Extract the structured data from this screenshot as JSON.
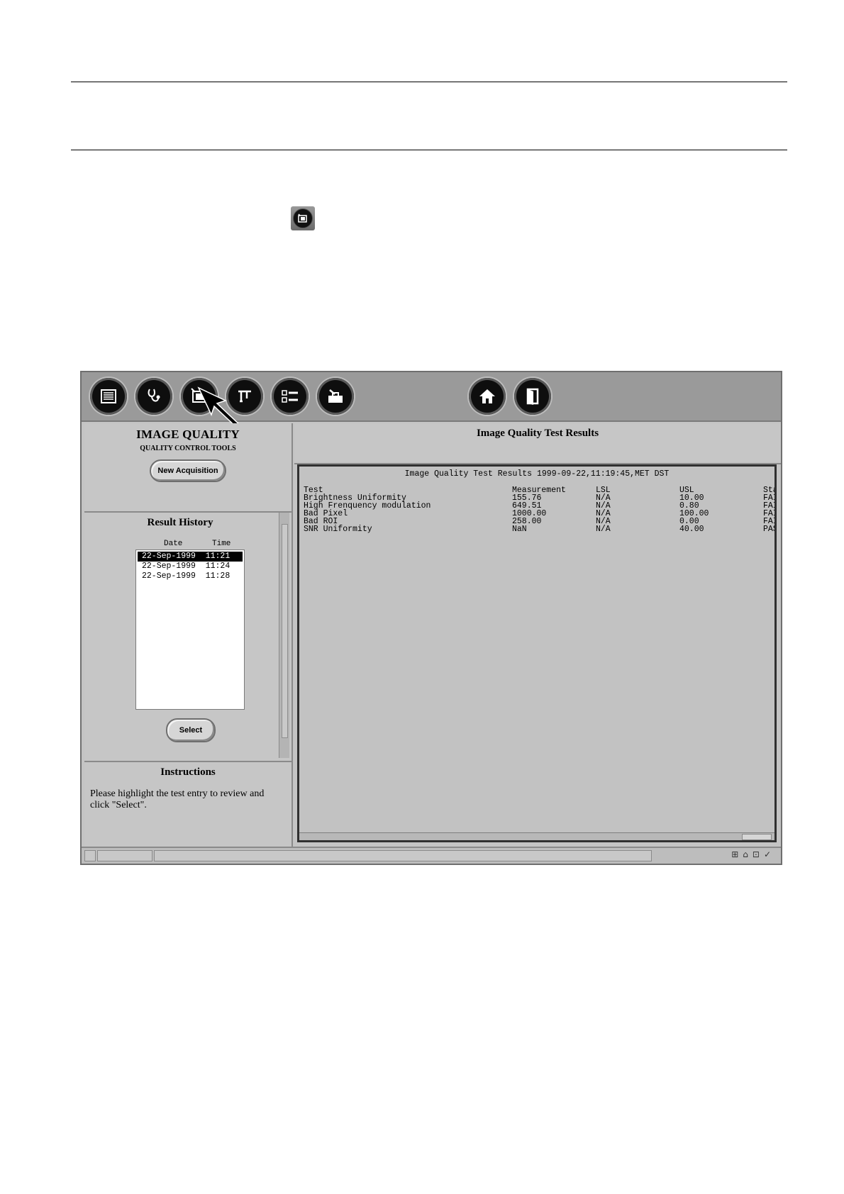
{
  "toolbar": {
    "buttons": [
      {
        "icon": "list-icon"
      },
      {
        "icon": "stethoscope-icon"
      },
      {
        "icon": "image-quality-icon"
      },
      {
        "icon": "caliper-icon"
      },
      {
        "icon": "checklist-icon"
      },
      {
        "icon": "toolbox-icon"
      },
      {
        "icon": "home-icon"
      },
      {
        "icon": "exit-door-icon"
      }
    ]
  },
  "left_panel": {
    "title": "IMAGE QUALITY",
    "subtitle": "QUALITY CONTROL TOOLS",
    "new_acquisition_label": "New Acquisition",
    "result_history": {
      "title": "Result History",
      "col_date": "Date",
      "col_time": "Time",
      "entries": [
        {
          "text": "22-Sep-1999  11:21",
          "selected": true
        },
        {
          "text": "22-Sep-1999  11:24",
          "selected": false
        },
        {
          "text": "22-Sep-1999  11:28",
          "selected": false
        }
      ],
      "select_label": "Select"
    },
    "instructions": {
      "title": "Instructions",
      "text": "Please highlight the test entry to review and click \"Select\"."
    }
  },
  "right_panel": {
    "header": "Image Quality Test Results",
    "report_title": "Image Quality Test Results 1999-09-22,11:19:45,MET DST",
    "columns": [
      "Test",
      "Measurement",
      "LSL",
      "USL",
      "Sta"
    ],
    "rows": [
      [
        "Brightness Uniformity",
        "155.76",
        "N/A",
        "10.00",
        "FAI"
      ],
      [
        "High Frenquency modulation",
        "649.51",
        "N/A",
        "0.80",
        "FAI"
      ],
      [
        "Bad Pixel",
        "1000.00",
        "N/A",
        "100.00",
        "FAI"
      ],
      [
        "Bad ROI",
        "258.00",
        "N/A",
        "0.00",
        "FAI"
      ],
      [
        "SNR Uniformity",
        "NaN",
        "N/A",
        "40.00",
        "PAS"
      ]
    ]
  }
}
